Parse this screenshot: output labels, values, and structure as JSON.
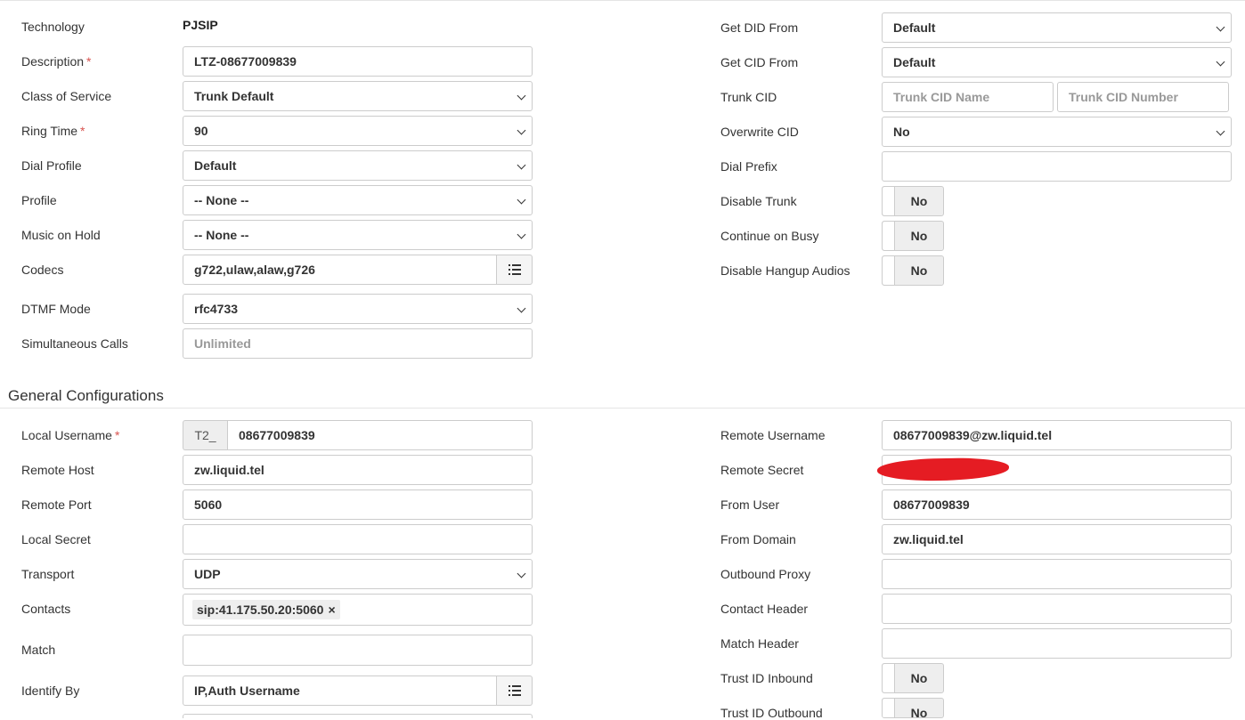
{
  "left_top": [
    {
      "key": "technology",
      "label": "Technology",
      "type": "text",
      "value": "PJSIP"
    },
    {
      "key": "description",
      "label": "Description",
      "required": true,
      "type": "input",
      "value": "LTZ-08677009839"
    },
    {
      "key": "class_of_service",
      "label": "Class of Service",
      "type": "select",
      "value": "Trunk Default"
    },
    {
      "key": "ring_time",
      "label": "Ring Time",
      "required": true,
      "type": "select",
      "value": "90"
    },
    {
      "key": "dial_profile",
      "label": "Dial Profile",
      "type": "select",
      "value": "Default"
    },
    {
      "key": "profile",
      "label": "Profile",
      "type": "select",
      "value": "-- None --"
    },
    {
      "key": "music_on_hold",
      "label": "Music on Hold",
      "type": "select",
      "value": "-- None --"
    },
    {
      "key": "codecs",
      "label": "Codecs",
      "type": "list-input",
      "value": "g722,ulaw,alaw,g726"
    },
    {
      "key": "dtmf_mode",
      "label": "DTMF Mode",
      "type": "select",
      "value": "rfc4733"
    },
    {
      "key": "simultaneous_calls",
      "label": "Simultaneous Calls",
      "type": "input",
      "placeholder": "Unlimited"
    }
  ],
  "right_top": [
    {
      "key": "get_did_from",
      "label": "Get DID From",
      "type": "select",
      "value": "Default"
    },
    {
      "key": "get_cid_from",
      "label": "Get CID From",
      "type": "select",
      "value": "Default"
    },
    {
      "key": "trunk_cid",
      "label": "Trunk CID",
      "type": "pair",
      "placeholder1": "Trunk CID Name",
      "placeholder2": "Trunk CID Number"
    },
    {
      "key": "overwrite_cid",
      "label": "Overwrite CID",
      "type": "select",
      "value": "No"
    },
    {
      "key": "dial_prefix",
      "label": "Dial Prefix",
      "type": "input",
      "value": ""
    },
    {
      "key": "disable_trunk",
      "label": "Disable Trunk",
      "type": "toggle",
      "value": "No"
    },
    {
      "key": "continue_on_busy",
      "label": "Continue on Busy",
      "type": "toggle",
      "value": "No"
    },
    {
      "key": "disable_hangup_audios",
      "label": "Disable Hangup Audios",
      "type": "toggle",
      "value": "No"
    }
  ],
  "section_title": "General Configurations",
  "left_bottom": [
    {
      "key": "local_username",
      "label": "Local Username",
      "required": true,
      "type": "prefix-input",
      "prefix": "T2_",
      "value": "08677009839"
    },
    {
      "key": "remote_host",
      "label": "Remote Host",
      "type": "input",
      "value": "zw.liquid.tel"
    },
    {
      "key": "remote_port",
      "label": "Remote Port",
      "type": "input",
      "value": "5060"
    },
    {
      "key": "local_secret",
      "label": "Local Secret",
      "type": "input",
      "value": ""
    },
    {
      "key": "transport",
      "label": "Transport",
      "type": "select",
      "value": "UDP"
    },
    {
      "key": "contacts",
      "label": "Contacts",
      "type": "tags",
      "tag": "sip:41.175.50.20:5060",
      "tag_remove": "×"
    },
    {
      "key": "match",
      "label": "Match",
      "type": "input",
      "value": ""
    },
    {
      "key": "identify_by",
      "label": "Identify By",
      "type": "list-input",
      "value": "IP,Auth Username"
    }
  ],
  "right_bottom": [
    {
      "key": "remote_username",
      "label": "Remote Username",
      "type": "input",
      "value": "08677009839@zw.liquid.tel"
    },
    {
      "key": "remote_secret",
      "label": "Remote Secret",
      "type": "input",
      "value": ""
    },
    {
      "key": "from_user",
      "label": "From User",
      "type": "input",
      "value": "08677009839"
    },
    {
      "key": "from_domain",
      "label": "From Domain",
      "type": "input",
      "value": "zw.liquid.tel"
    },
    {
      "key": "outbound_proxy",
      "label": "Outbound Proxy",
      "type": "input",
      "value": ""
    },
    {
      "key": "contact_header",
      "label": "Contact Header",
      "type": "input",
      "value": ""
    },
    {
      "key": "match_header",
      "label": "Match Header",
      "type": "input",
      "value": ""
    },
    {
      "key": "trust_id_inbound",
      "label": "Trust ID Inbound",
      "type": "toggle",
      "value": "No"
    },
    {
      "key": "trust_id_outbound",
      "label": "Trust ID Outbound",
      "type": "toggle",
      "value": "No"
    }
  ],
  "colors": {
    "required": "#d9534f",
    "redaction": "#e51c23",
    "border": "#cccccc"
  },
  "icons": {
    "list": "list-icon",
    "chevron": "chevron-down-icon"
  }
}
